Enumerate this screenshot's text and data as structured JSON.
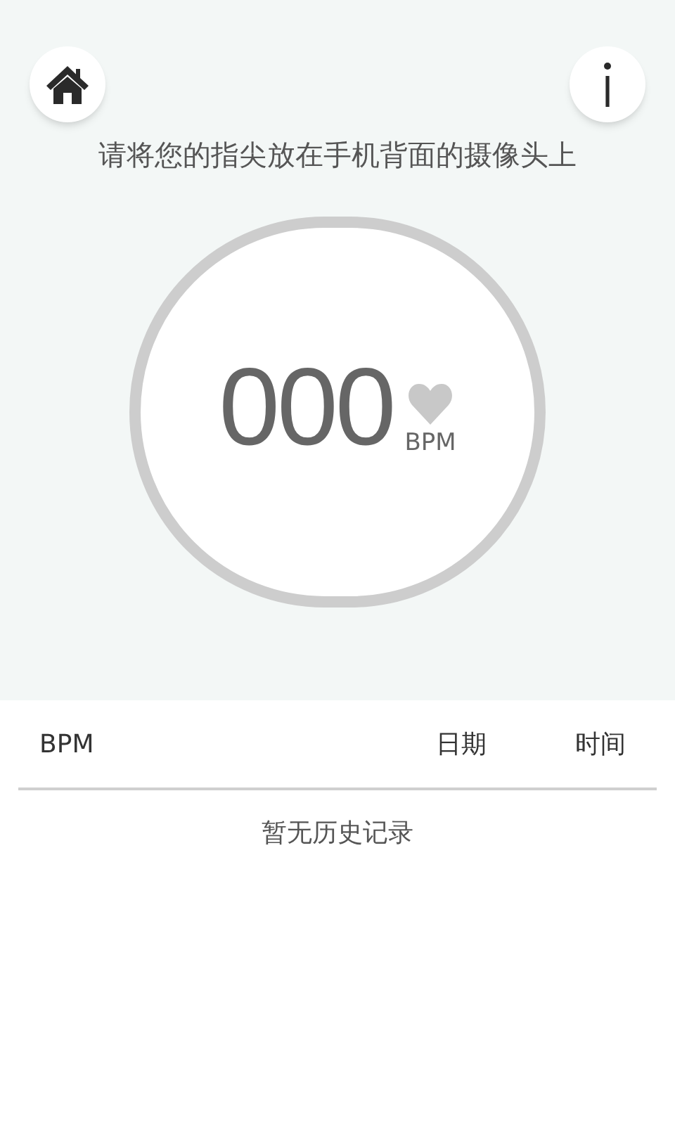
{
  "instruction": "请将您的指尖放在手机背面的摄像头上",
  "reading": {
    "value": "000",
    "unit": "BPM"
  },
  "history": {
    "columns": [
      "BPM",
      "日期",
      "时间"
    ],
    "empty_message": "暂无历史记录"
  }
}
